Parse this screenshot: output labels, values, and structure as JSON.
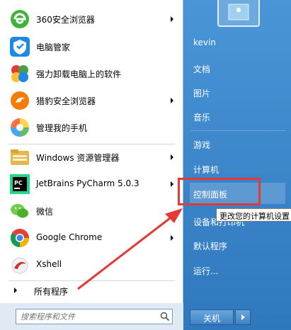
{
  "programs": [
    {
      "label": "360安全浏览器",
      "icon": "360-browser-icon",
      "has_submenu": true
    },
    {
      "label": "电脑管家",
      "icon": "tencent-pc-manager-icon",
      "has_submenu": false
    },
    {
      "label": "强力卸载电脑上的软件",
      "icon": "uninstaller-icon",
      "has_submenu": false
    },
    {
      "label": "猎豹安全浏览器",
      "icon": "cheetah-browser-icon",
      "has_submenu": true
    },
    {
      "label": "管理我的手机",
      "icon": "phone-manager-icon",
      "has_submenu": false
    },
    {
      "label": "Windows 资源管理器",
      "icon": "windows-explorer-icon",
      "has_submenu": true
    },
    {
      "label": "JetBrains PyCharm 5.0.3",
      "icon": "pycharm-icon",
      "has_submenu": true
    },
    {
      "label": "微信",
      "icon": "wechat-icon",
      "has_submenu": false
    },
    {
      "label": "Google Chrome",
      "icon": "chrome-icon",
      "has_submenu": true
    },
    {
      "label": "Xshell",
      "icon": "xshell-icon",
      "has_submenu": false
    }
  ],
  "all_programs": {
    "label": "所有程序"
  },
  "search": {
    "placeholder": "搜索程序和文件"
  },
  "right_links": [
    {
      "label": "kevin"
    },
    {
      "label": "文档"
    },
    {
      "label": "图片"
    },
    {
      "label": "音乐"
    },
    {
      "label": "游戏"
    },
    {
      "label": "计算机"
    },
    {
      "label": "控制面板"
    },
    {
      "label": "设备和打印机"
    },
    {
      "label": "默认程序"
    },
    {
      "label": "运行..."
    }
  ],
  "tooltip": {
    "text": "更改您的计算机设置"
  },
  "shutdown": {
    "label": "关机"
  },
  "colors": {
    "highlight": "#e53935",
    "panel_blue": "#3c86c8"
  }
}
